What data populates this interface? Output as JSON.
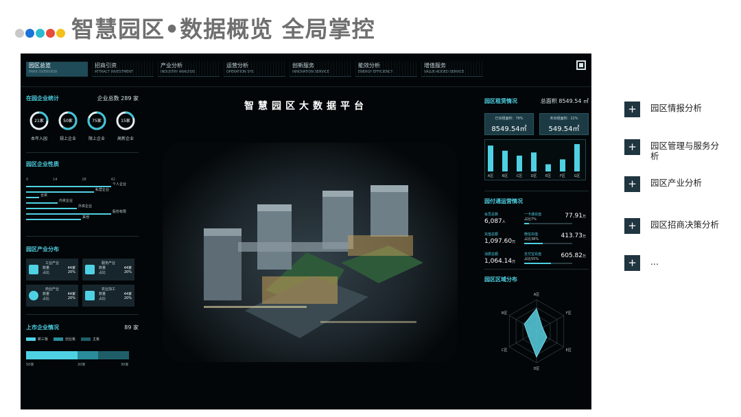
{
  "slide": {
    "title": "智慧园区•数据概览  全局掌控",
    "dot_colors": [
      "#c8c8c8",
      "#1a73d8",
      "#2bbad0",
      "#e84a3c",
      "#f3c11a"
    ]
  },
  "dashboard": {
    "nav": [
      {
        "zh": "园区总览",
        "en": "PARK OVERVIEW"
      },
      {
        "zh": "招商引资",
        "en": "ATTRACT INVESTMENT"
      },
      {
        "zh": "产业分析",
        "en": "INDUSTRY ANALYSIS"
      },
      {
        "zh": "运营分析",
        "en": "OPERATION SYS"
      },
      {
        "zh": "创新服务",
        "en": "INNOVATION SERVICE"
      },
      {
        "zh": "能效分析",
        "en": "ENERGY EFFICIENCY"
      },
      {
        "zh": "增值服务",
        "en": "VALUE-ADDED SERVICE"
      }
    ],
    "center_title": "智慧园区大数据平台",
    "enterprise_stats": {
      "title": "在园企业统计",
      "total": "企业总数 289 家",
      "rings": [
        {
          "value": "21家",
          "label": "本年入园",
          "fraction": 0.25
        },
        {
          "value": "50家",
          "label": "规上企业",
          "fraction": 0.6
        },
        {
          "value": "75家",
          "label": "限上企业",
          "fraction": 0.8
        },
        {
          "value": "15家",
          "label": "高新企业",
          "fraction": 0.2
        }
      ]
    },
    "enterprise_nature": {
      "title": "园区企业性质",
      "axis": [
        "0",
        "14",
        "28",
        "42"
      ],
      "bars": [
        {
          "label": "个人企业",
          "value": 40
        },
        {
          "label": "私营企业",
          "value": 32
        },
        {
          "label": "合资",
          "value": 6
        },
        {
          "label": "内资企业",
          "value": 15
        },
        {
          "label": "外资企业",
          "value": 24
        },
        {
          "label": "股份有限",
          "value": 40
        },
        {
          "label": "其他",
          "value": 26
        }
      ]
    },
    "industry_dist": {
      "title": "园区产业分布",
      "count_label": "数量",
      "share_label": "占比",
      "cards": [
        {
          "name": "工业产业",
          "count": "44家",
          "share": "20%",
          "icon": "factory-icon"
        },
        {
          "name": "服务产业",
          "count": "44家",
          "share": "20%",
          "icon": "heart-hand-icon"
        },
        {
          "name": "商业产业",
          "count": "44家",
          "share": "20%",
          "icon": "coin-icon"
        },
        {
          "name": "农业加工",
          "count": "44家",
          "share": "20%",
          "icon": "satellite-icon"
        }
      ]
    },
    "listed": {
      "title": "上市企业情况",
      "total": "89 家",
      "legend": [
        {
          "label": "新三板",
          "color": "#4fd1e4"
        },
        {
          "label": "创业板",
          "color": "#2a8c9a"
        },
        {
          "label": "主板",
          "color": "#1f5e68"
        }
      ],
      "segments": [
        {
          "value": 50,
          "label": "50家",
          "color": "#4fd1e4"
        },
        {
          "value": 20,
          "label": "20家",
          "color": "#2a8c9a"
        },
        {
          "value": 30,
          "label": "30家",
          "color": "#1f5e68"
        }
      ]
    },
    "rental": {
      "title": "园区租赁情况",
      "total_area": "总面积 8549.54 ㎡",
      "cards": [
        {
          "label": "已出租面积：78%",
          "value": "8549.54㎡"
        },
        {
          "label": "未出租面积：22%",
          "value": "549.54㎡"
        }
      ],
      "bars": [
        {
          "label": "A区",
          "value": 0.9
        },
        {
          "label": "B区",
          "value": 0.72
        },
        {
          "label": "C区",
          "value": 0.55
        },
        {
          "label": "D区",
          "value": 0.66
        },
        {
          "label": "E区",
          "value": 0.25
        },
        {
          "label": "F区",
          "value": 0.42
        },
        {
          "label": "G区",
          "value": 0.95
        }
      ]
    },
    "operations": {
      "title": "园付通运营情况",
      "items": [
        {
          "left_label": "会员总数",
          "left_value": "6,087",
          "left_unit": "人",
          "right_label": "一卡通充值",
          "right_pct": "占比7%",
          "right_value": "77.91",
          "right_unit": "万",
          "fill": 0.07
        },
        {
          "left_label": "充值总额",
          "left_value": "1,097.60",
          "left_unit": "万",
          "right_label": "微信充值",
          "right_pct": "占比38%",
          "right_value": "413.73",
          "right_unit": "万",
          "fill": 0.38
        },
        {
          "left_label": "消费总额",
          "left_value": "1,064.14",
          "left_unit": "万",
          "right_label": "支付宝充值",
          "right_pct": "占比55%",
          "right_value": "605.82",
          "right_unit": "万",
          "fill": 0.55
        }
      ]
    },
    "region_dist": {
      "title": "园区区域分布",
      "axes": [
        "A区",
        "F区",
        "E区",
        "D区",
        "C区",
        "B区"
      ],
      "values": [
        0.72,
        0.22,
        0.38,
        0.82,
        0.3,
        0.45
      ]
    }
  },
  "outline": [
    {
      "symbol": "+",
      "label": "园区情报分析"
    },
    {
      "symbol": "+",
      "label": "园区管理与服务分析"
    },
    {
      "symbol": "+",
      "label": "园区产业分析"
    },
    {
      "symbol": "+",
      "label": "园区招商决策分析"
    },
    {
      "symbol": "+",
      "label": "..."
    }
  ]
}
